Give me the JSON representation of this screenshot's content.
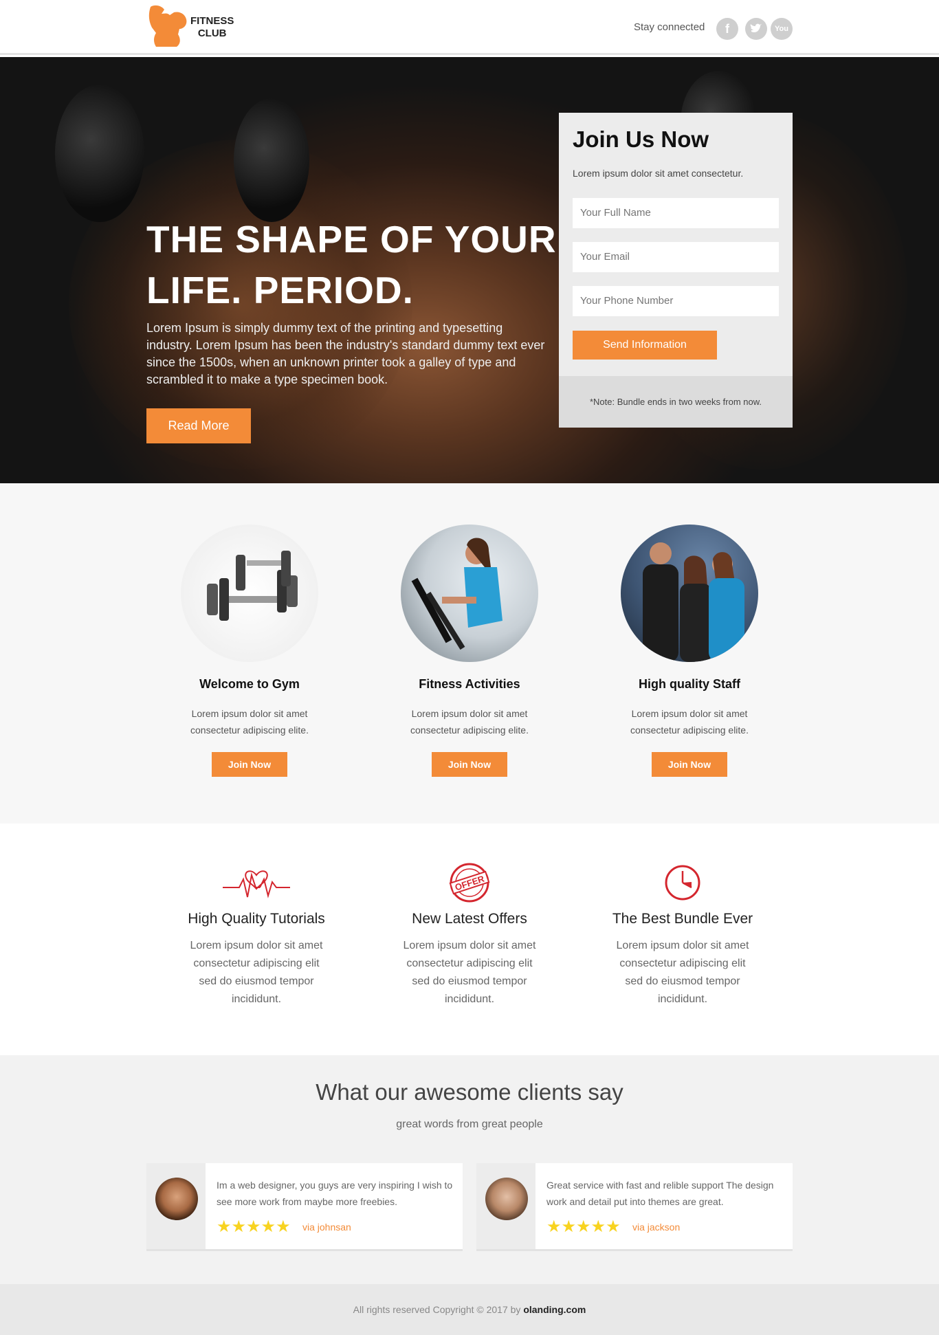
{
  "header": {
    "logo_line1": "FITNESS",
    "logo_line2": "CLUB",
    "stay_connected": "Stay connected",
    "social": [
      {
        "icon": "facebook-icon",
        "glyph": "f"
      },
      {
        "icon": "twitter-icon",
        "glyph": "t"
      },
      {
        "icon": "youtube-icon",
        "glyph": "You"
      }
    ]
  },
  "hero": {
    "title_line1": "THE SHAPE OF YOUR",
    "title_line2": "LIFE. PERIOD.",
    "text": "Lorem Ipsum is simply dummy text of the printing and typesetting industry. Lorem Ipsum has been the industry's standard dummy text ever since the 1500s, when an unknown printer took a galley of type and scrambled it to make a type specimen book.",
    "read_more": "Read More"
  },
  "join_form": {
    "title": "Join Us Now",
    "subtitle": "Lorem ipsum dolor sit amet consectetur.",
    "full_name_placeholder": "Your Full Name",
    "email_placeholder": "Your Email",
    "phone_placeholder": "Your Phone Number",
    "submit": "Send Information",
    "note": "*Note: Bundle ends in two weeks from now."
  },
  "features": [
    {
      "title": "Welcome to Gym",
      "line1": "Lorem ipsum dolor sit amet",
      "line2": "consectetur adipiscing elite.",
      "button": "Join Now"
    },
    {
      "title": "Fitness Activities",
      "line1": "Lorem ipsum dolor sit amet",
      "line2": "consectetur adipiscing elite.",
      "button": "Join Now"
    },
    {
      "title": "High quality Staff",
      "line1": "Lorem ipsum dolor sit amet",
      "line2": "consectetur adipiscing elite.",
      "button": "Join Now"
    }
  ],
  "benefits": [
    {
      "icon": "heartbeat-icon",
      "title": "High Quality Tutorials",
      "l1": "Lorem ipsum dolor sit amet",
      "l2": "consectetur adipiscing elit",
      "l3": "sed do eiusmod tempor",
      "l4": "incididunt."
    },
    {
      "icon": "offer-stamp-icon",
      "title": "New Latest Offers",
      "stamp": "OFFER",
      "l1": "Lorem ipsum dolor sit amet",
      "l2": "consectetur adipiscing elit",
      "l3": "sed do eiusmod tempor",
      "l4": "incididunt."
    },
    {
      "icon": "clock-icon",
      "title": "The Best Bundle Ever",
      "l1": "Lorem ipsum dolor sit amet",
      "l2": "consectetur adipiscing elit",
      "l3": "sed do eiusmod tempor",
      "l4": "incididunt."
    }
  ],
  "testimonials": {
    "title": "What our awesome clients say",
    "subtitle": "great words from great people",
    "items": [
      {
        "text": "Im a web designer, you guys are very inspiring I wish to see more work from maybe more freebies.",
        "stars": "★★★★★",
        "via": "via johnsan"
      },
      {
        "text": "Great service with fast and relible support The design work and detail put into themes are great.",
        "stars": "★★★★★",
        "via": "via jackson"
      }
    ]
  },
  "footer": {
    "text": "All rights reserved Copyright © 2017 by",
    "link": "olanding.com"
  },
  "colors": {
    "accent": "#f38b38",
    "icon_red": "#d4262e",
    "star": "#f8d320"
  }
}
